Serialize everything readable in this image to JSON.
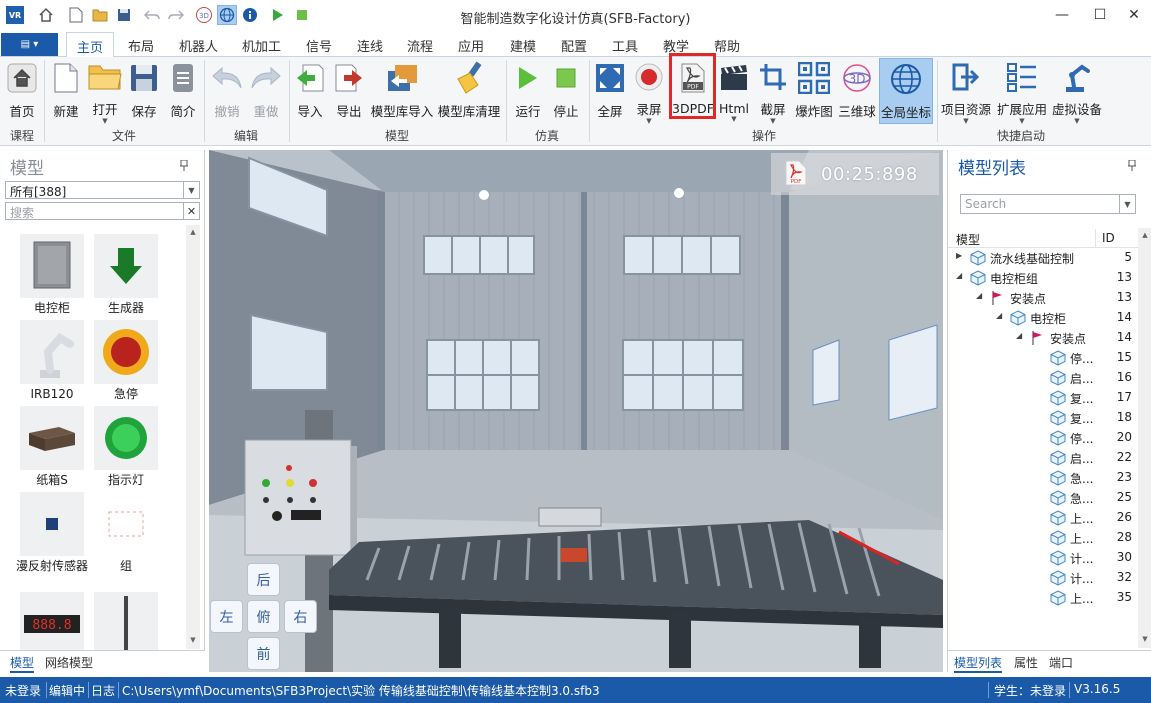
{
  "window": {
    "title": "智能制造数字化设计仿真(SFB-Factory)",
    "logo": "VR",
    "quick_access": [
      "home-icon",
      "new-icon",
      "open-icon",
      "save-icon",
      "undo-icon",
      "redo-icon",
      "3d-icon",
      "globe-icon",
      "info-icon",
      "play-icon",
      "stop-icon"
    ],
    "controls": {
      "minimize": "—",
      "maximize": "☐",
      "close": "✕"
    }
  },
  "menu": {
    "file_button": "▤ ▾",
    "tabs": [
      "主页",
      "布局",
      "机器人",
      "机加工",
      "信号",
      "连线",
      "流程",
      "应用",
      "建模",
      "配置",
      "工具",
      "教学",
      "帮助"
    ],
    "active_tab": "主页"
  },
  "ribbon": {
    "groups": {
      "course": "课程",
      "file": "文件",
      "edit": "编辑",
      "model": "模型",
      "sim": "仿真",
      "operate": "操作",
      "quick": "快捷启动"
    },
    "buttons": {
      "home": "首页",
      "new": "新建",
      "open": "打开",
      "save": "保存",
      "summary": "简介",
      "undo": "撤销",
      "redo": "重做",
      "import": "导入",
      "export": "导出",
      "lib_import": "模型库导入",
      "lib_clean": "模型库清理",
      "run": "运行",
      "stop": "停止",
      "fullscreen": "全屏",
      "record": "录屏",
      "pdf3d": "3DPDF",
      "html": "Html",
      "screenshot": "截屏",
      "explode": "爆炸图",
      "ball3d": "三维球",
      "global_coord": "全局坐标",
      "project_res": "项目资源",
      "ext_app": "扩展应用",
      "virtual_dev": "虚拟设备"
    }
  },
  "left_panel": {
    "title": "模型",
    "filter": "所有[388]",
    "search_placeholder": "搜索",
    "items": [
      "电控柜",
      "生成器",
      "IRB120",
      "急停",
      "纸箱S",
      "指示灯",
      "漫反射传感器",
      "组",
      "",
      ""
    ],
    "display_value": "888.8",
    "tabs": [
      "模型",
      "网络模型"
    ]
  },
  "viewport": {
    "record_time": "00:25:898",
    "nav": {
      "back": "后",
      "left": "左",
      "top": "俯",
      "right": "右",
      "front": "前"
    }
  },
  "right_panel": {
    "title": "模型列表",
    "search_placeholder": "Search",
    "columns": {
      "model": "模型",
      "id": "ID"
    },
    "rows": [
      {
        "label": "流水线基础控制",
        "id": "5"
      },
      {
        "label": "电控柜组",
        "id": "13"
      },
      {
        "label": "安装点",
        "id": "13"
      },
      {
        "label": "电控柜",
        "id": "14"
      },
      {
        "label": "安装点",
        "id": "14"
      },
      {
        "label": "停...",
        "id": "15"
      },
      {
        "label": "启...",
        "id": "16"
      },
      {
        "label": "复...",
        "id": "17"
      },
      {
        "label": "复...",
        "id": "18"
      },
      {
        "label": "停...",
        "id": "20"
      },
      {
        "label": "启...",
        "id": "22"
      },
      {
        "label": "急...",
        "id": "23"
      },
      {
        "label": "急...",
        "id": "25"
      },
      {
        "label": "上...",
        "id": "26"
      },
      {
        "label": "上...",
        "id": "28"
      },
      {
        "label": "计...",
        "id": "30"
      },
      {
        "label": "计...",
        "id": "32"
      },
      {
        "label": "上...",
        "id": "35"
      }
    ],
    "tabs": [
      "模型列表",
      "属性",
      "端口"
    ]
  },
  "status": {
    "login": "未登录",
    "mode": "编辑中",
    "log": "日志",
    "path": "C:\\Users\\ymf\\Documents\\SFB3Project\\实验 传输线基础控制\\传输线基本控制3.0.sfb3",
    "student": "学生：未登录",
    "version": "V3.16.5"
  },
  "colors": {
    "accent": "#1a5aa8",
    "highlight_box": "#e02828",
    "ribbon_bg": "#f5f6f7",
    "selected_button": "#a9cdf0"
  }
}
